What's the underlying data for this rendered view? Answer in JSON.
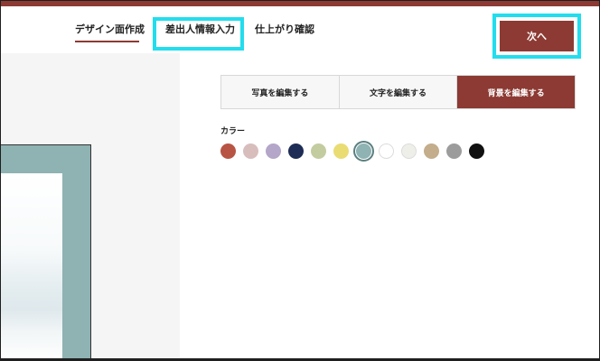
{
  "header": {
    "steps": [
      {
        "label": "デザイン面作成"
      },
      {
        "label": "差出人情報入力"
      },
      {
        "label": "仕上がり確認"
      }
    ],
    "next_label": "次へ"
  },
  "tabs": [
    {
      "label": "写真を編集する",
      "active": false
    },
    {
      "label": "文字を編集する",
      "active": false
    },
    {
      "label": "背景を編集する",
      "active": true
    }
  ],
  "color_section": {
    "label": "カラー",
    "swatches": [
      "#b85443",
      "#d8bdbd",
      "#b3a6c9",
      "#1e2d55",
      "#c3cc9f",
      "#e9dc73",
      "#8fb2b2",
      "#ffffff",
      "#efefe9",
      "#c3ad8b",
      "#9c9c9c",
      "#111111"
    ],
    "selected_index": 6
  },
  "colors": {
    "accent": "#8c3a33",
    "highlight": "#22dded",
    "canvas_background": "#8fb2b2"
  }
}
